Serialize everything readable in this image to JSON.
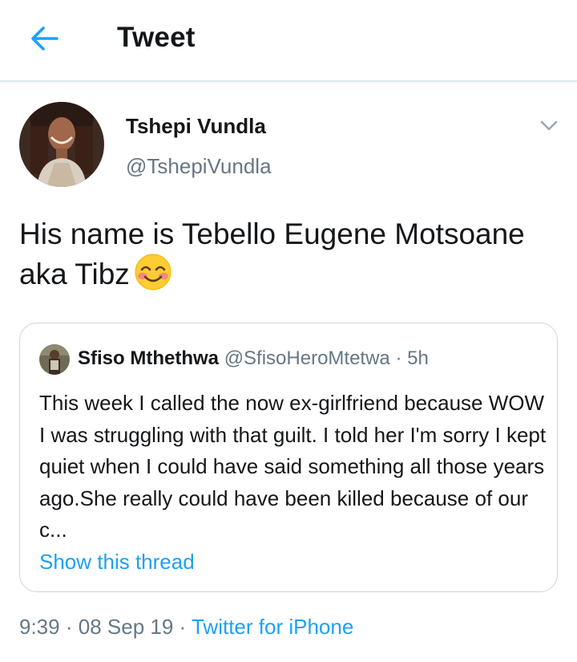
{
  "header": {
    "title": "Tweet",
    "back_icon": "arrow-left-icon",
    "accent_color": "#1da1f2"
  },
  "tweet": {
    "author_name": "Tshepi Vundla",
    "author_handle": "@TshepiVundla",
    "text": "His name is Tebello Eugene Motsoane aka Tibz",
    "emoji_icon": "smiling-face-with-smiling-eyes-icon",
    "caret_icon": "chevron-down-icon"
  },
  "quoted_tweet": {
    "author_name": "Sfiso Mthethwa",
    "author_handle": "@SfisoHeroMtetwa",
    "separator": "·",
    "time": "5h",
    "text": "This week I called the now ex-girlfriend because WOW I was struggling with that guilt. I told her I'm sorry I kept quiet when I could have said something all those years ago.She really could have been killed because of our c...",
    "show_thread": "Show this thread"
  },
  "footer": {
    "time": "9:39",
    "separator": "·",
    "date": "08 Sep 19",
    "source": "Twitter for iPhone"
  }
}
